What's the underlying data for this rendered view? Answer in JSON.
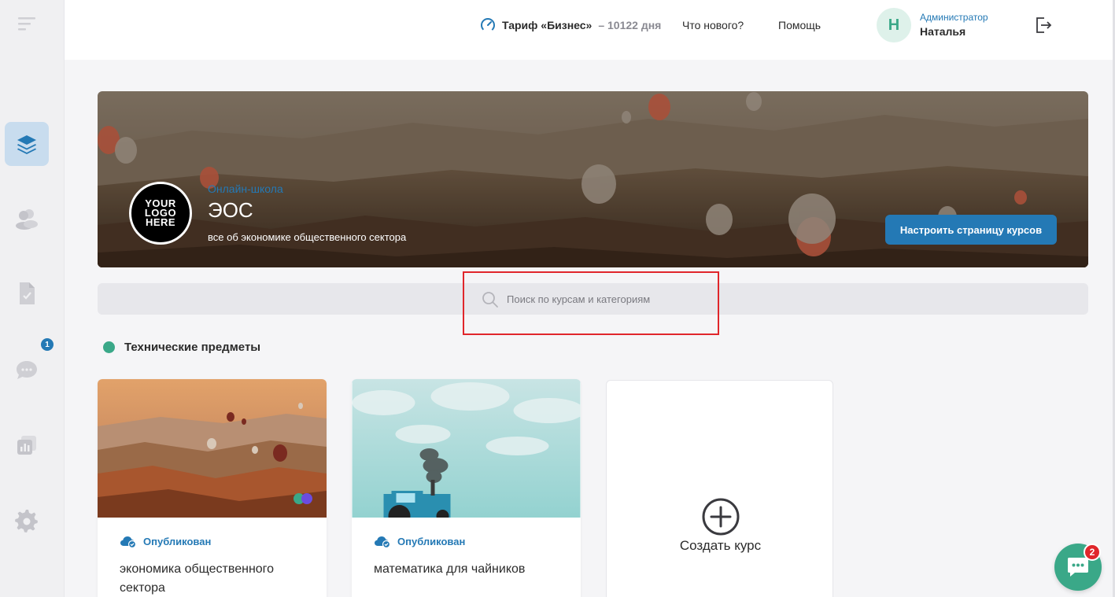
{
  "header": {
    "tariff_name": "Тариф «Бизнес»",
    "tariff_days": "– 10122 дня",
    "whats_new": "Что нового?",
    "help": "Помощь",
    "avatar_letter": "Н",
    "user_role": "Администратор",
    "user_name": "Наталья"
  },
  "sidebar": {
    "messages_badge": "1",
    "icons": [
      "menu-icon",
      "layers-icon",
      "users-icon",
      "assignments-icon",
      "chat-icon",
      "analytics-icon",
      "settings-icon"
    ]
  },
  "banner": {
    "logo_text": "YOUR LOGO HERE",
    "school_type": "Онлайн-школа",
    "school_name": "ЭОС",
    "school_desc": "все об экономике общественного сектора",
    "config_button": "Настроить страницу курсов"
  },
  "search": {
    "placeholder": "Поиск по курсам и категориям"
  },
  "category": {
    "title": "Технические предметы",
    "color": "#3aa888"
  },
  "courses": [
    {
      "status": "Опубликован",
      "title": "экономика общественного сектора"
    },
    {
      "status": "Опубликован",
      "title": "математика для чайников"
    }
  ],
  "create_course": "Создать курс",
  "chat": {
    "badge": "2"
  },
  "colors": {
    "accent": "#2479b5",
    "green": "#3aa888",
    "alert": "#e0262b"
  }
}
